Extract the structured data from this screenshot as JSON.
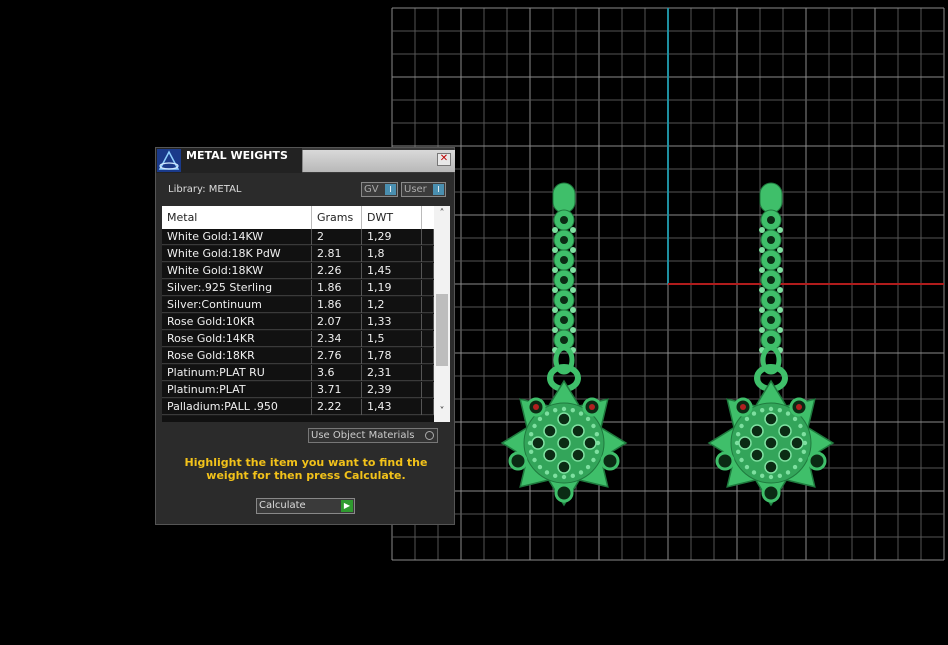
{
  "panel": {
    "title": "METAL WEIGHTS",
    "close_symbol": "✕",
    "icon": "app-logo-icon",
    "library_label": "Library: METAL",
    "toggles": [
      {
        "label": "GV",
        "indicator": "I"
      },
      {
        "label": "User",
        "indicator": "I"
      }
    ],
    "table": {
      "columns": [
        "Metal",
        "Grams",
        "DWT"
      ],
      "rows": [
        [
          "White Gold:14KW",
          "2",
          "1,29"
        ],
        [
          "White Gold:18K PdW",
          "2.81",
          "1,8"
        ],
        [
          "White Gold:18KW",
          "2.26",
          "1,45"
        ],
        [
          "Silver:.925 Sterling",
          "1.86",
          "1,19"
        ],
        [
          "Silver:Continuum",
          "1.86",
          "1,2"
        ],
        [
          "Rose Gold:10KR",
          "2.07",
          "1,33"
        ],
        [
          "Rose Gold:14KR",
          "2.34",
          "1,5"
        ],
        [
          "Rose Gold:18KR",
          "2.76",
          "1,78"
        ],
        [
          "Platinum:PLAT RU",
          "3.6",
          "2,31"
        ],
        [
          "Platinum:PLAT",
          "3.71",
          "2,39"
        ],
        [
          "Palladium:PALL .950",
          "2.22",
          "1,43"
        ]
      ],
      "scroll_up": "˄",
      "scroll_down": "˅"
    },
    "use_object_materials": "Use Object Materials",
    "instructions": "Highlight the item you want to find the weight for then press Calculate.",
    "calculate_label": "Calculate",
    "calculate_arrow": "▶"
  },
  "colors": {
    "background": "#000000",
    "grid": "#555555",
    "axis_vertical": "#1e8fa0",
    "axis_horizontal": "#b01c1c",
    "model_green": "#3fbf6a",
    "instructions": "#f2c21a"
  }
}
